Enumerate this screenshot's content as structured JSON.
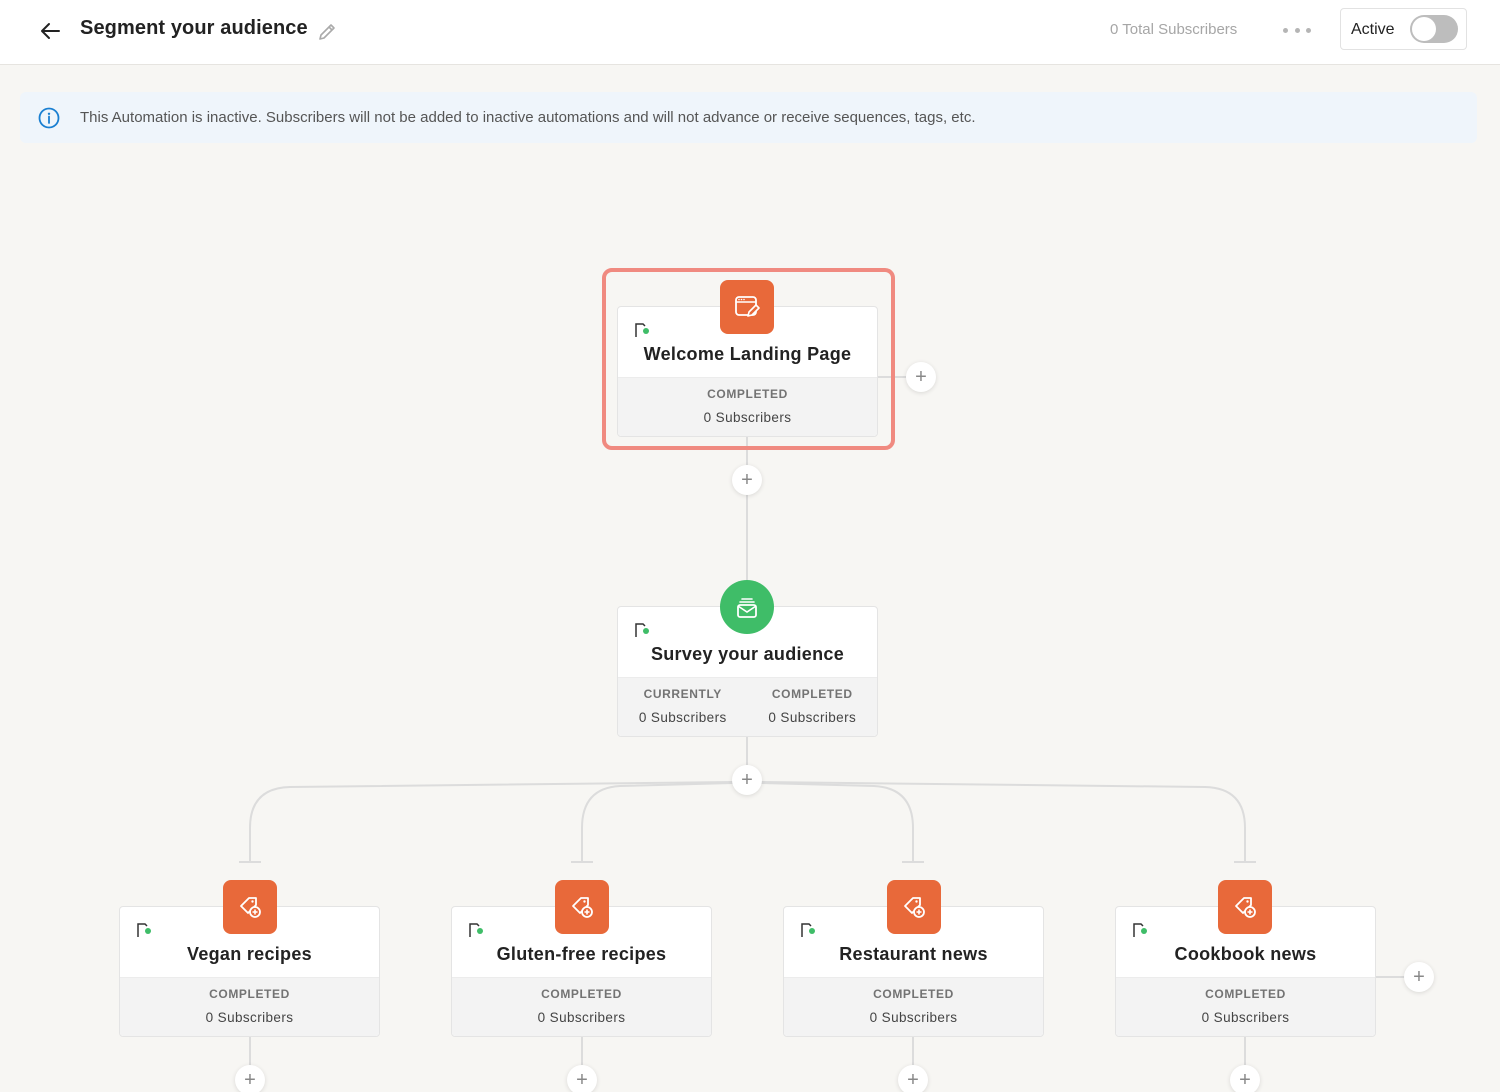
{
  "header": {
    "title": "Segment your audience",
    "total_subscribers": "0 Total Subscribers",
    "active_label": "Active",
    "active_on": false
  },
  "banner": {
    "text": "This Automation is inactive. Subscribers will not be added to inactive automations and will not advance or receive sequences, tags, etc."
  },
  "colors": {
    "accent_orange": "#e8693a",
    "accent_green": "#3fbd68",
    "highlight": "#f08a80",
    "info_blue": "#1a7fd1"
  },
  "nodes": {
    "entry": {
      "name": "Welcome Landing Page",
      "icon": "landing-page-icon",
      "stats": [
        {
          "label": "COMPLETED",
          "value": "0 Subscribers"
        }
      ]
    },
    "survey": {
      "name": "Survey your audience",
      "icon": "email-sequence-icon",
      "stats": [
        {
          "label": "CURRENTLY",
          "value": "0 Subscribers"
        },
        {
          "label": "COMPLETED",
          "value": "0 Subscribers"
        }
      ]
    },
    "branches": [
      {
        "name": "Vegan recipes",
        "icon": "tag-add-icon",
        "stats": [
          {
            "label": "COMPLETED",
            "value": "0 Subscribers"
          }
        ]
      },
      {
        "name": "Gluten-free recipes",
        "icon": "tag-add-icon",
        "stats": [
          {
            "label": "COMPLETED",
            "value": "0 Subscribers"
          }
        ]
      },
      {
        "name": "Restaurant news",
        "icon": "tag-add-icon",
        "stats": [
          {
            "label": "COMPLETED",
            "value": "0 Subscribers"
          }
        ]
      },
      {
        "name": "Cookbook news",
        "icon": "tag-add-icon",
        "stats": [
          {
            "label": "COMPLETED",
            "value": "0 Subscribers"
          }
        ]
      }
    ]
  },
  "add_step_symbol": "+"
}
